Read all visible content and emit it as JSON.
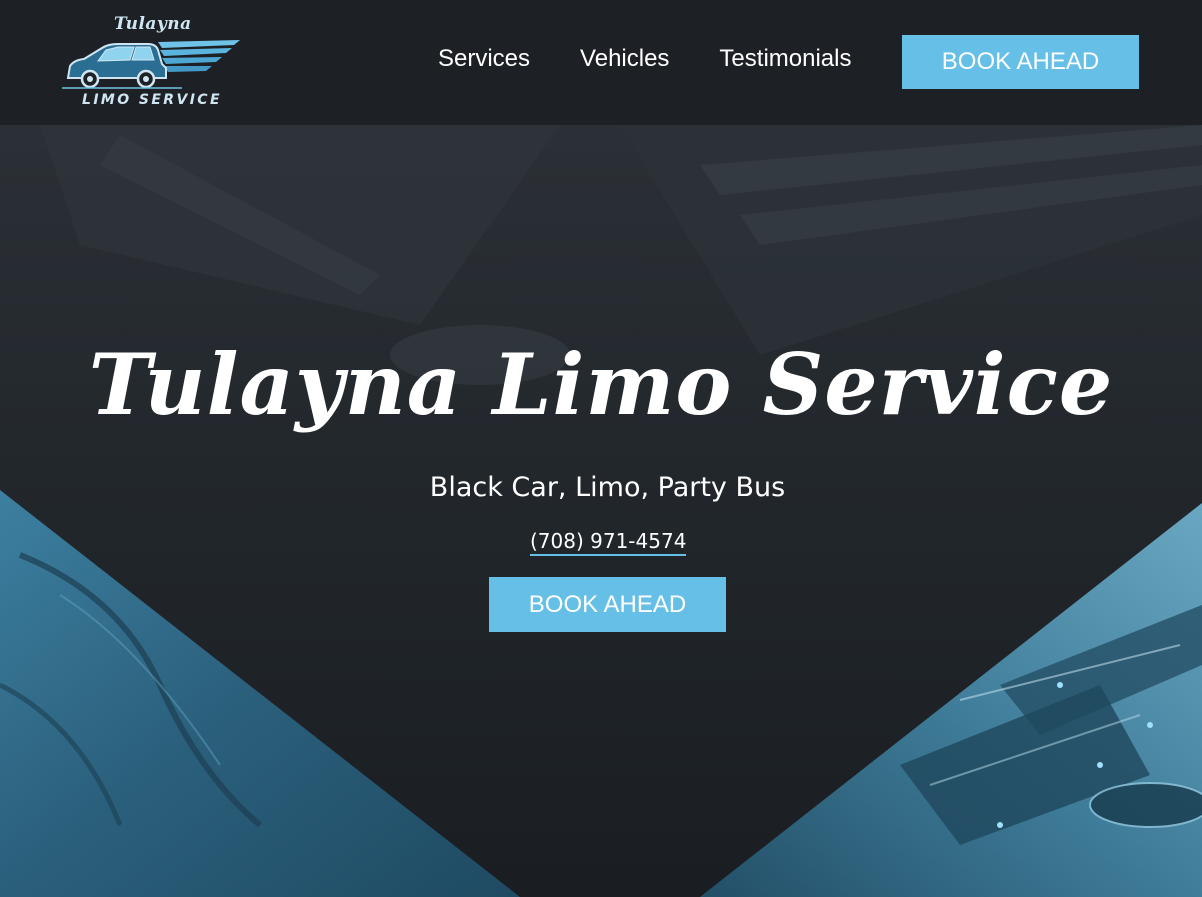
{
  "logo": {
    "brand_top": "Tulayna",
    "brand_bottom": "LIMO SERVICE"
  },
  "nav": {
    "items": [
      {
        "label": "Services"
      },
      {
        "label": "Vehicles"
      },
      {
        "label": "Testimonials"
      }
    ],
    "cta_label": "BOOK AHEAD"
  },
  "hero": {
    "title": "Tulayna Limo Service",
    "subtitle": "Black Car, Limo, Party Bus",
    "phone": "(708) 971-4574",
    "cta_label": "BOOK AHEAD"
  },
  "colors": {
    "background": "#1d2125",
    "accent": "#65bfe6",
    "text": "#ffffff",
    "hero_blue": "#2a5d78"
  }
}
